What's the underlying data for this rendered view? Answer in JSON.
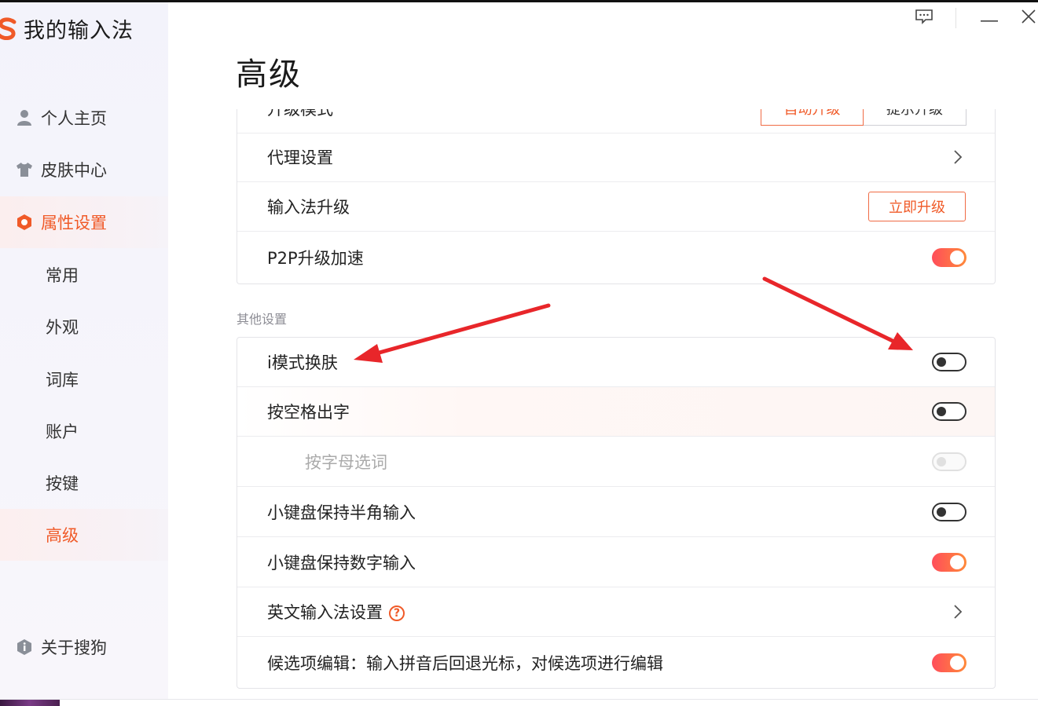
{
  "app": {
    "title": "我的输入法"
  },
  "sidebar": {
    "items": [
      {
        "label": "个人主页",
        "icon": "user-icon"
      },
      {
        "label": "皮肤中心",
        "icon": "shirt-icon"
      },
      {
        "label": "属性设置",
        "icon": "hexagon-settings-icon",
        "active": true
      }
    ],
    "subitems": [
      {
        "label": "常用"
      },
      {
        "label": "外观"
      },
      {
        "label": "词库"
      },
      {
        "label": "账户"
      },
      {
        "label": "按键"
      },
      {
        "label": "高级",
        "active": true
      }
    ],
    "about": {
      "label": "关于搜狗",
      "icon": "info-shield-icon"
    }
  },
  "window_controls": {
    "feedback": "feedback-icon",
    "minimize": "minimize-icon",
    "close": "close-icon"
  },
  "main": {
    "title": "高级",
    "upgrade_card": {
      "partial_row_label": "升级模式",
      "segment_options": [
        "自动升级",
        "提示升级"
      ],
      "rows": [
        {
          "label": "代理设置",
          "control": "chevron"
        },
        {
          "label": "输入法升级",
          "control": "button",
          "button_label": "立即升级"
        },
        {
          "label": "P2P升级加速",
          "control": "toggle",
          "state": "on"
        }
      ]
    },
    "other_section_label": "其他设置",
    "other_card": {
      "rows": [
        {
          "label": "i模式换肤",
          "control": "toggle",
          "state": "off"
        },
        {
          "label": "按空格出字",
          "control": "toggle",
          "state": "off"
        },
        {
          "label": "按字母选词",
          "control": "toggle",
          "state": "disabled"
        },
        {
          "label": "小键盘保持半角输入",
          "control": "toggle",
          "state": "off"
        },
        {
          "label": "小键盘保持数字输入",
          "control": "toggle",
          "state": "on"
        },
        {
          "label": "英文输入法设置",
          "control": "chevron",
          "help": "?"
        },
        {
          "label": "候选项编辑：输入拼音后回退光标，对候选项进行编辑",
          "control": "toggle",
          "state": "on"
        }
      ]
    }
  },
  "colors": {
    "accent": "#f05a28",
    "toggle_on_start": "#ff4d5a",
    "toggle_on_end": "#ff8a3a",
    "annotation_arrow": "#e8262a"
  }
}
